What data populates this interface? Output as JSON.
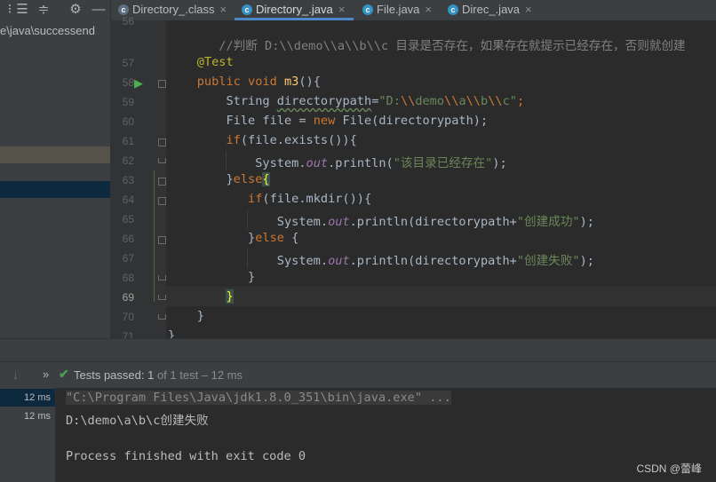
{
  "toolbar": {
    "icons": [
      "list-icon",
      "collapse-all-icon",
      "expand-all-icon",
      "gear-icon",
      "minimize-icon"
    ]
  },
  "tabs": [
    {
      "label": "Directory_.class",
      "icon": "class-icon",
      "active": false
    },
    {
      "label": "Directory_.java",
      "icon": "java-class-icon",
      "active": true
    },
    {
      "label": "File.java",
      "icon": "java-class-icon",
      "active": false
    },
    {
      "label": "Direc_.java",
      "icon": "java-class-icon",
      "active": false
    }
  ],
  "project": {
    "path": "e\\java\\successend"
  },
  "editor": {
    "line_numbers": [
      "56",
      "57",
      "58",
      "59",
      "60",
      "61",
      "62",
      "63",
      "64",
      "65",
      "66",
      "67",
      "68",
      "69",
      "70",
      "71"
    ],
    "current_line": "69",
    "lines": {
      "l56": {
        "comment": "//判断 D:\\\\demo\\\\a\\\\b\\\\c 目录是否存在，如果存在就提示已经存在，否则就创建"
      },
      "l57": {
        "annotation": "@Test"
      },
      "l58": {
        "kw1": "public",
        "kw2": "void",
        "fn": "m3",
        "rest": "(){"
      },
      "l59": {
        "type": "String ",
        "var": "directorypath",
        "eq": "=",
        "s1": "\"D:",
        "e1": "\\\\",
        "s2": "demo",
        "e2": "\\\\",
        "s3": "a",
        "e3": "\\\\",
        "s4": "b",
        "e4": "\\\\",
        "s5": "c\"",
        "end": ";"
      },
      "l60": {
        "pre": "File file = ",
        "kw": "new",
        "post": " File(directorypath);"
      },
      "l61": {
        "kw": "if",
        "post": "(file.exists()){"
      },
      "l62": {
        "pre": "System.",
        "fld": "out",
        "mid": ".println(",
        "str": "\"该目录已经存在\"",
        "end": ");"
      },
      "l63": {
        "pre": "}",
        "kw": "else",
        "brace": "{"
      },
      "l64": {
        "kw": "if",
        "post": "(file.mkdir()){"
      },
      "l65": {
        "pre": "System.",
        "fld": "out",
        "mid": ".println(directorypath+",
        "str": "\"创建成功\"",
        "end": ");"
      },
      "l66": {
        "pre": "}",
        "kw": "else",
        "post": " {"
      },
      "l67": {
        "pre": "System.",
        "fld": "out",
        "mid": ".println(directorypath+",
        "str": "\"创建失败\"",
        "end": ");"
      },
      "l68": {
        "text": "}"
      },
      "l69": {
        "brace": "}"
      },
      "l70": {
        "text": "}"
      },
      "l71": {
        "text": "}"
      }
    }
  },
  "run": {
    "status_prefix": "Tests passed: ",
    "status_count": "1",
    "status_suffix": " of 1 test – 12 ms",
    "tests": [
      {
        "time": "12 ms"
      },
      {
        "time": "12 ms"
      }
    ],
    "console": [
      "\"C:\\Program Files\\Java\\jdk1.8.0_351\\bin\\java.exe\" ...",
      "D:\\demo\\a\\b\\c创建失败",
      "",
      "Process finished with exit code 0"
    ]
  },
  "watermark": "CSDN @蕾峰"
}
